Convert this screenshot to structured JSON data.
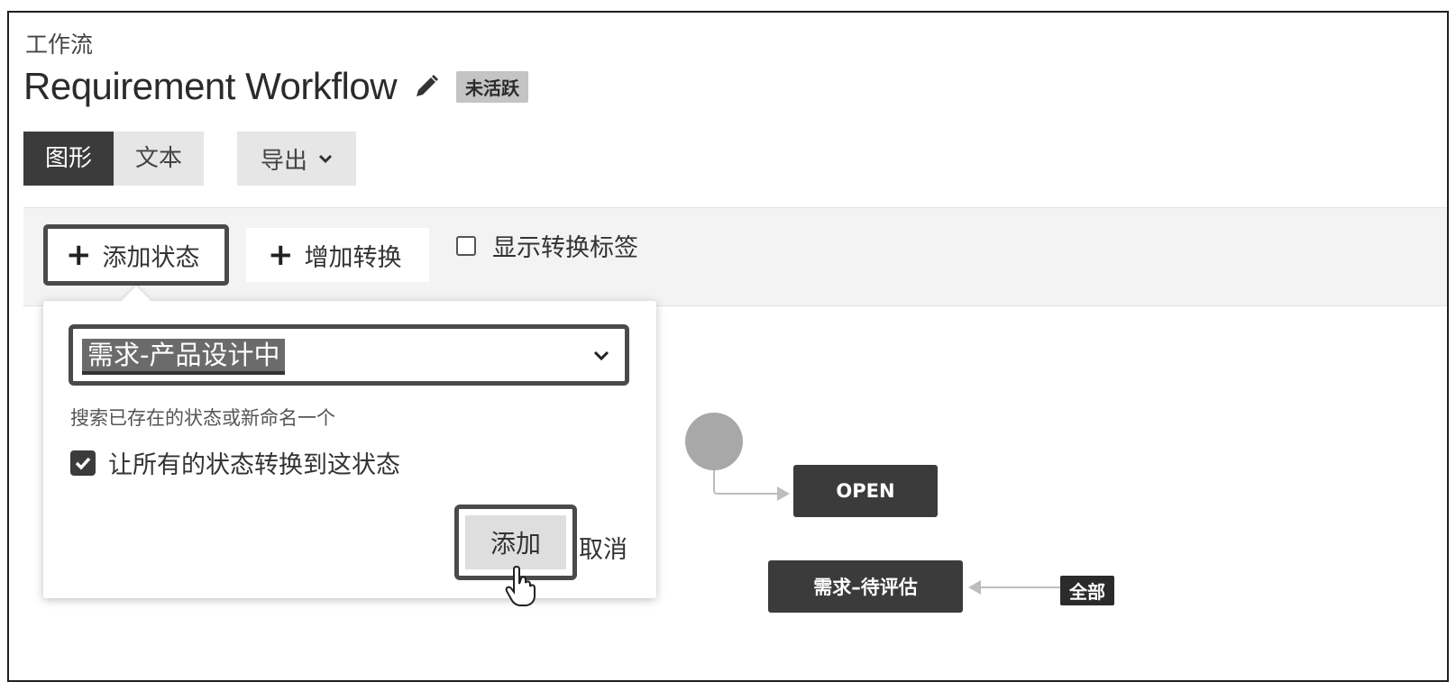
{
  "breadcrumb": "工作流",
  "header": {
    "title": "Requirement Workflow",
    "status_badge": "未活跃",
    "edit_icon": "pencil-icon"
  },
  "view_tabs": {
    "graph": "图形",
    "text": "文本",
    "export": "导出"
  },
  "toolbar": {
    "add_status": "添加状态",
    "add_transition": "增加转换",
    "show_transition_labels": "显示转换标签"
  },
  "popover": {
    "selected_status": "需求-产品设计中",
    "hint": "搜索已存在的状态或新命名一个",
    "allow_all_transitions": "让所有的状态转换到这状态",
    "add_button": "添加",
    "cancel_link": "取消"
  },
  "diagram": {
    "nodes": [
      "OPEN",
      "需求–待评估"
    ],
    "all_tag": "全部"
  },
  "colors": {
    "node": "#3b3b3b",
    "start_node": "#a8a8a8",
    "highlight_border": "#4a4a4a"
  }
}
